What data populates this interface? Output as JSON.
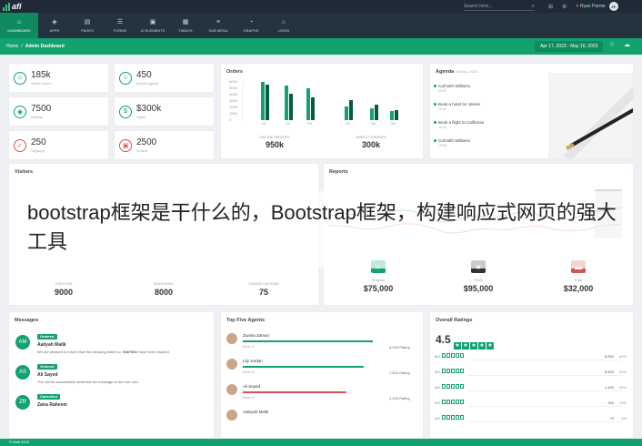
{
  "brand": {
    "name": "afi"
  },
  "topbar": {
    "search_placeholder": "Search here...",
    "user_name": "Ryan Parme",
    "user_initials": "ZF"
  },
  "nav": {
    "items": [
      {
        "label": "DASHBOARD",
        "icon": "home-icon",
        "glyph": "⌂",
        "active": true
      },
      {
        "label": "APPS",
        "icon": "cube-icon",
        "glyph": "◈"
      },
      {
        "label": "PAGES",
        "icon": "pages-icon",
        "glyph": "▤"
      },
      {
        "label": "FORMS",
        "icon": "forms-icon",
        "glyph": "☰"
      },
      {
        "label": "UI ELEMENTS",
        "icon": "layers-icon",
        "glyph": "▣"
      },
      {
        "label": "TABLES",
        "icon": "table-icon",
        "glyph": "▦"
      },
      {
        "label": "SUB MENU",
        "icon": "menu-icon",
        "glyph": "≡"
      },
      {
        "label": "GRAPHS",
        "icon": "chart-icon",
        "glyph": "◔"
      },
      {
        "label": "LOGIN",
        "icon": "lock-icon",
        "glyph": "⌂"
      }
    ]
  },
  "breadcrumb": {
    "home": "Home",
    "separator": "/",
    "current": "Admin Dashboard",
    "date_range": "Apr 17, 2023 - May 16, 2023"
  },
  "stats": [
    {
      "value": "185k",
      "label": "Active Users",
      "color": "#12a26f",
      "icon": "user-icon",
      "glyph": "☺"
    },
    {
      "value": "450",
      "label": "Active Agents",
      "color": "#12a26f",
      "icon": "agent-icon",
      "glyph": "☺"
    },
    {
      "value": "7500",
      "label": "Visitors",
      "color": "#12a26f",
      "icon": "eye-icon",
      "glyph": "◉"
    },
    {
      "value": "$300k",
      "label": "Sales",
      "color": "#12a26f",
      "icon": "dollar-icon",
      "glyph": "$"
    },
    {
      "value": "250",
      "label": "Signups",
      "color": "#d9534f",
      "icon": "check-icon",
      "glyph": "✓"
    },
    {
      "value": "2500",
      "label": "Orders",
      "color": "#d9534f",
      "icon": "cart-icon",
      "glyph": "▣"
    }
  ],
  "orders": {
    "title": "Orders",
    "online_label": "ONLINE ORDERS",
    "online_value": "950k",
    "direct_label": "DIRECT ORDERS",
    "direct_value": "300k"
  },
  "agenda": {
    "title": "Agenda",
    "date": "16 May, 2023",
    "items": [
      {
        "text": "Call with Williams",
        "time": "09:00"
      },
      {
        "text": "Book a hotel for James",
        "time": "10:30"
      },
      {
        "text": "Book a flight to California",
        "time": "13:00"
      },
      {
        "text": "Call with Williams",
        "time": "15:00"
      }
    ]
  },
  "visitors": {
    "title": "Visitors",
    "items": [
      {
        "label": "VISITORS",
        "value": "9000"
      },
      {
        "label": "BOOKINGS",
        "value": "8000"
      },
      {
        "label": "CANCELLATIONS",
        "value": "75"
      }
    ]
  },
  "reports": {
    "title": "Reports",
    "items": [
      {
        "label": "Projects",
        "value": "$75,000",
        "color": "#12a26f",
        "icon": "plus-icon",
        "glyph": "+"
      },
      {
        "label": "Profit",
        "value": "$95,000",
        "color": "#333333",
        "icon": "star-icon",
        "glyph": "★"
      },
      {
        "label": "Paid",
        "value": "$32,000",
        "color": "#d9534f",
        "icon": "wallet-icon",
        "glyph": "▬"
      }
    ]
  },
  "overlay": {
    "text": "bootstrap框架是干什么的，Bootstrap框架，构建响应式网页的强大工具"
  },
  "messages": {
    "title": "Messages",
    "items": [
      {
        "initials": "AM",
        "badge": "Ordered",
        "badge_color": "#12a26f",
        "name": "Aaliyah Malik",
        "text_pre": "We are pleased to inform that the following ticket no. ",
        "ticket": "WAFI810",
        "text_post": " have been booked."
      },
      {
        "initials": "AS",
        "badge": "Ordered",
        "badge_color": "#12a26f",
        "name": "Ali Sayed",
        "text_pre": "The carrier successfully delivered the message to the end user.",
        "ticket": "",
        "text_post": ""
      },
      {
        "initials": "ZR",
        "badge": "Cancelled",
        "badge_color": "#12a26f",
        "name": "Zaira Raheem",
        "text_pre": "",
        "ticket": "",
        "text_post": ""
      }
    ]
  },
  "agents": {
    "title": "Top Five Agents",
    "items": [
      {
        "name": "Zuaina Zaman",
        "rank": "Rank #1",
        "rating": "8,000 Rating",
        "fill": 0.75,
        "color": "#12a26f"
      },
      {
        "name": "Lily Jordan",
        "rank": "Rank #2",
        "rating": "7,500 Rating",
        "fill": 0.7,
        "color": "#12a26f"
      },
      {
        "name": "Ali Sayed",
        "rank": "Rank #3",
        "rating": "4,200 Rating",
        "fill": 0.6,
        "color": "#d9534f"
      },
      {
        "name": "Aaleyah Malik",
        "rank": "",
        "rating": "",
        "fill": 0,
        "color": "#12a26f"
      }
    ]
  },
  "ratings": {
    "title": "Overall Ratings",
    "average": "4.5",
    "rows": [
      {
        "label": "5.0",
        "count": "8,500",
        "pct": "80%"
      },
      {
        "label": "4.0",
        "count": "8,500",
        "pct": "80%"
      },
      {
        "label": "3.0",
        "count": "1,400",
        "pct": "20%"
      },
      {
        "label": "2.0",
        "count": "300",
        "pct": "10%"
      },
      {
        "label": "1.0",
        "count": "75",
        "pct": "5%"
      }
    ]
  },
  "footer": {
    "text": "© Wafi 2020"
  },
  "chart_data": [
    {
      "type": "bar",
      "title": "Orders",
      "categories": [
        "S1",
        "S2",
        "S3",
        "S4",
        "S5",
        "S6"
      ],
      "y_ticks": [
        "6000",
        "5000",
        "4000",
        "3000",
        "2000",
        "1000",
        "0"
      ],
      "series": [
        {
          "values": [
            6000,
            5400,
            5000,
            2100,
            1800,
            1400
          ],
          "color": "#12a26f"
        },
        {
          "values": [
            5600,
            4100,
            3600,
            3200,
            2400,
            1600
          ],
          "color": "#0a5a3c"
        }
      ],
      "ylim": [
        0,
        6000
      ]
    }
  ]
}
